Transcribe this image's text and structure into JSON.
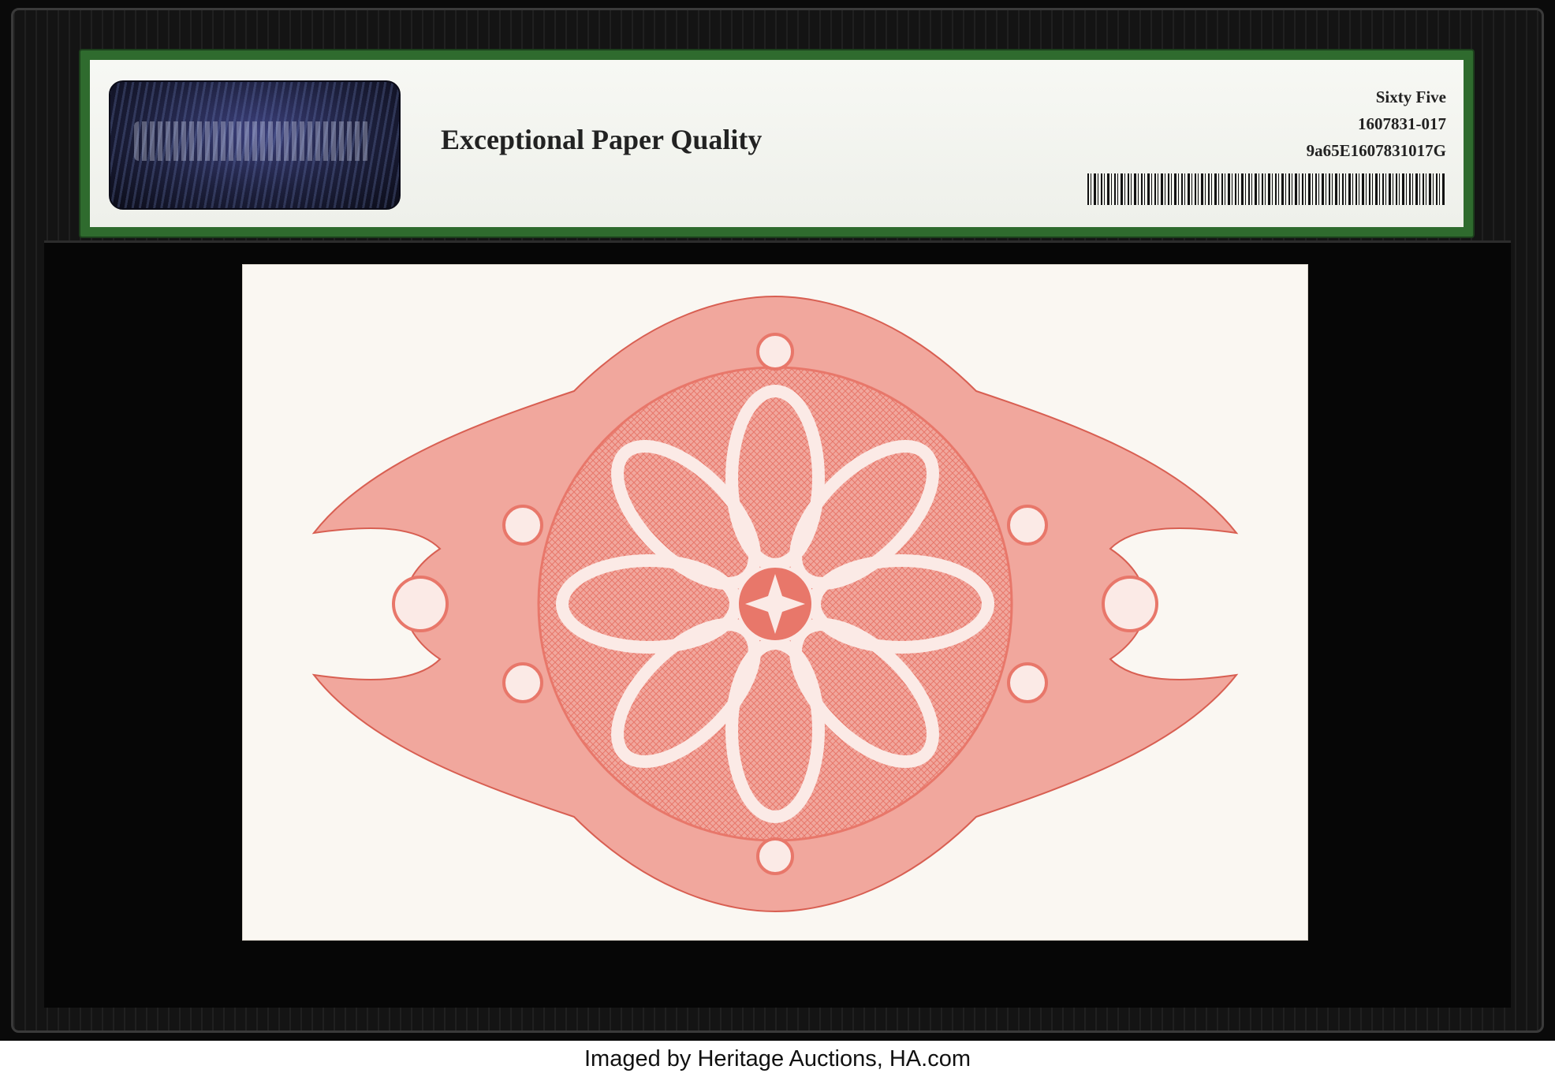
{
  "label": {
    "title": "Exceptional Paper Quality",
    "grade": "Sixty Five",
    "cert_number": "1607831-017",
    "barcode_text": "9a65E1607831017G"
  },
  "caption": "Imaged by Heritage Auctions, HA.com",
  "colors": {
    "label_border": "#2f6b2e",
    "ornament": "#e8776a",
    "note_paper": "#faf7f2",
    "holder": "#0a0a0a"
  }
}
